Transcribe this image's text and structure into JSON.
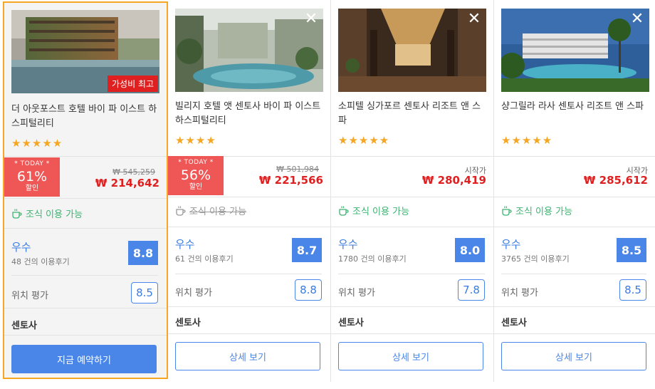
{
  "cards": [
    {
      "name": "더 아웃포스트 호텔 바이 파 이스트 하스피털리티",
      "stars": "★★★★★",
      "badge": "가성비 최고",
      "today_label": "* TODAY *",
      "discount": "61%",
      "discount_label": "할인",
      "original_price": "₩ 545,259",
      "price": "₩ 214,642",
      "breakfast": "조식 이용 가능",
      "breakfast_available": true,
      "rating_label": "우수",
      "reviews": "48 건의 이용후기",
      "score": "8.8",
      "location_label": "위치 평가",
      "location_score": "8.5",
      "area": "센토사",
      "button": "지금 예약하기"
    },
    {
      "name": "빌리지 호텔 앳 센토사 바이 파 이스트 하스피털리티",
      "stars": "★★★★",
      "today_label": "* TODAY *",
      "discount": "56%",
      "discount_label": "할인",
      "original_price": "₩ 501,984",
      "price": "₩ 221,566",
      "breakfast": "조식 이용 가능",
      "breakfast_available": false,
      "rating_label": "우수",
      "reviews": "61 건의 이용후기",
      "score": "8.7",
      "location_label": "위치 평가",
      "location_score": "8.8",
      "area": "센토사",
      "button": "상세 보기",
      "close": "✕"
    },
    {
      "name": "소피텔 싱가포르 센토사 리조트 앤 스파",
      "stars": "★★★★★",
      "from_label": "시작가",
      "price": "₩ 280,419",
      "breakfast": "조식 이용 가능",
      "breakfast_available": true,
      "rating_label": "우수",
      "reviews": "1780 건의 이용후기",
      "score": "8.0",
      "location_label": "위치 평가",
      "location_score": "7.8",
      "area": "센토사",
      "button": "상세 보기",
      "close": "✕"
    },
    {
      "name": "샹그릴라 라사 센토사 리조트 앤 스파",
      "stars": "★★★★★",
      "from_label": "시작가",
      "price": "₩ 285,612",
      "breakfast": "조식 이용 가능",
      "breakfast_available": true,
      "rating_label": "우수",
      "reviews": "3765 건의 이용후기",
      "score": "8.5",
      "location_label": "위치 평가",
      "location_score": "8.5",
      "area": "센토사",
      "button": "상세 보기",
      "close": "✕"
    }
  ],
  "colors": {
    "accent": "#4a86e8",
    "price": "#e02020",
    "today": "#ef5656",
    "breakfast": "#3cb371",
    "star": "#f5a623",
    "highlight_border": "#f5a623"
  },
  "icons": {
    "breakfast": "coffee-cup-icon",
    "close": "close-icon"
  }
}
